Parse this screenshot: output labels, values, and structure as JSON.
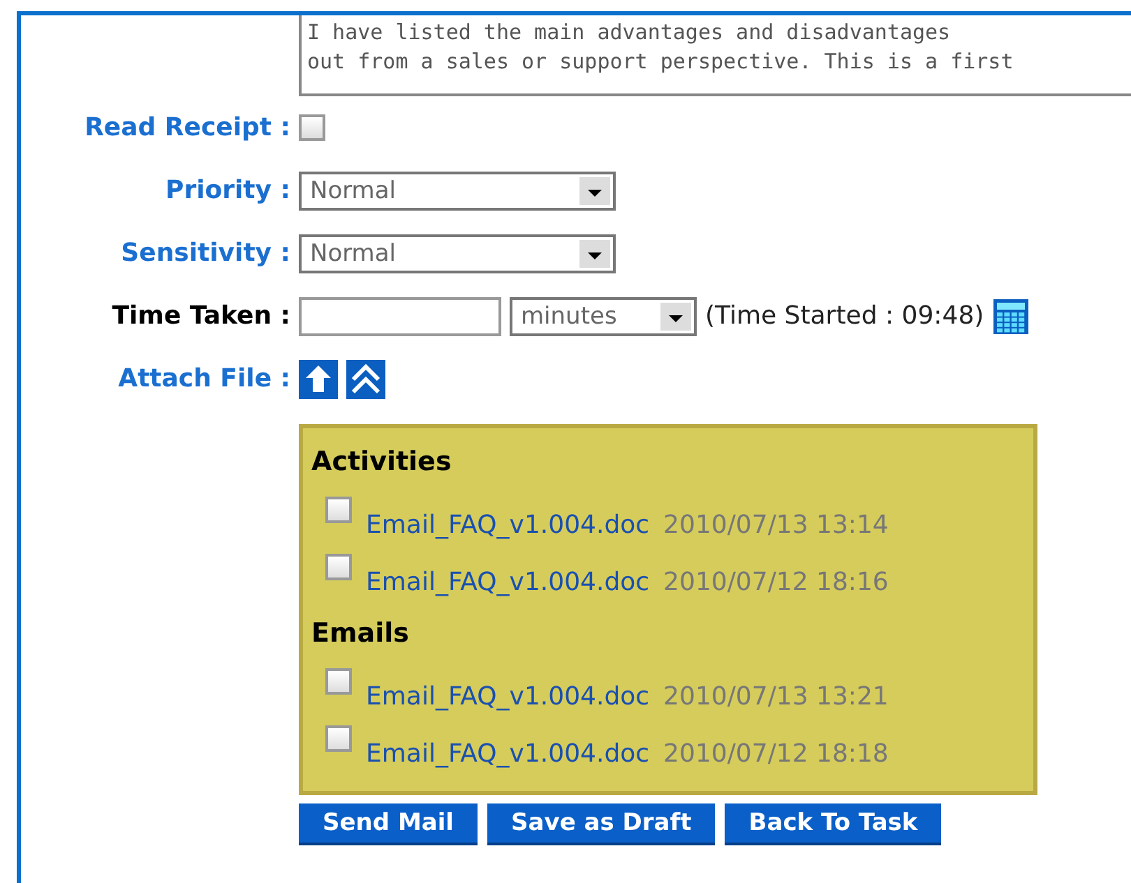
{
  "message": {
    "value": "I have listed the main advantages and disadvantages\nout from a sales or support perspective. This is a first"
  },
  "read_receipt": {
    "label": "Read Receipt :",
    "checked": false
  },
  "priority": {
    "label": "Priority :",
    "value": "Normal"
  },
  "sensitivity": {
    "label": "Sensitivity :",
    "value": "Normal"
  },
  "time_taken": {
    "label": "Time Taken :",
    "unit": "minutes",
    "time_started": "(Time Started : 09:48)"
  },
  "attach_file": {
    "label": "Attach File :"
  },
  "attachments": [
    {
      "heading": "Activities",
      "files": [
        {
          "name": "Email_FAQ_v1.004.doc",
          "date": "2010/07/13 13:14",
          "checked": false
        },
        {
          "name": "Email_FAQ_v1.004.doc",
          "date": "2010/07/12 18:16",
          "checked": false
        }
      ]
    },
    {
      "heading": "Emails",
      "files": [
        {
          "name": "Email_FAQ_v1.004.doc",
          "date": "2010/07/13 13:21",
          "checked": false
        },
        {
          "name": "Email_FAQ_v1.004.doc",
          "date": "2010/07/12 18:18",
          "checked": false
        }
      ]
    }
  ],
  "buttons": [
    "Send Mail",
    "Save as Draft",
    "Back To Task"
  ]
}
